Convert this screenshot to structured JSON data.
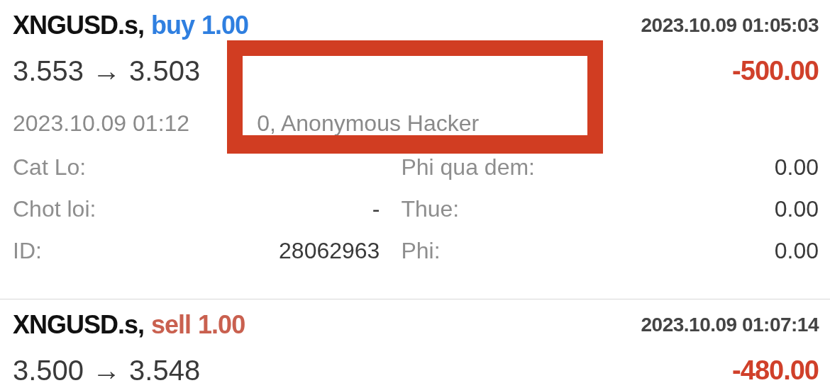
{
  "trades": [
    {
      "symbol": "XNGUSD.s,",
      "side": "buy",
      "color": "#2f7fe0",
      "volume": "1.00",
      "time": "2023.10.09 01:05:03",
      "open_price": "3.553",
      "arrow": "→",
      "close_price": "3.503",
      "profit": "-500.00",
      "comment_parts": [
        "2023.10.09 01:12",
        "0, Anonymous Hacker"
      ],
      "details": [
        {
          "label": "Cat Lo:",
          "label2": "Phi qua dem:",
          "value2": "0.00"
        },
        {
          "label": "Chot loi:",
          "value": "-",
          "label2": "Thue:",
          "value2": "0.00"
        },
        {
          "label": "ID:",
          "value": "28062963",
          "label2": "Phi:",
          "value2": "0.00"
        }
      ]
    },
    {
      "symbol": "XNGUSD.s,",
      "side": "sell",
      "color": "#c9604f",
      "volume": "1.00",
      "time": "2023.10.09 01:07:14",
      "open_price": "3.500",
      "arrow": "→",
      "close_price": "3.548",
      "profit": "-480.00"
    }
  ]
}
